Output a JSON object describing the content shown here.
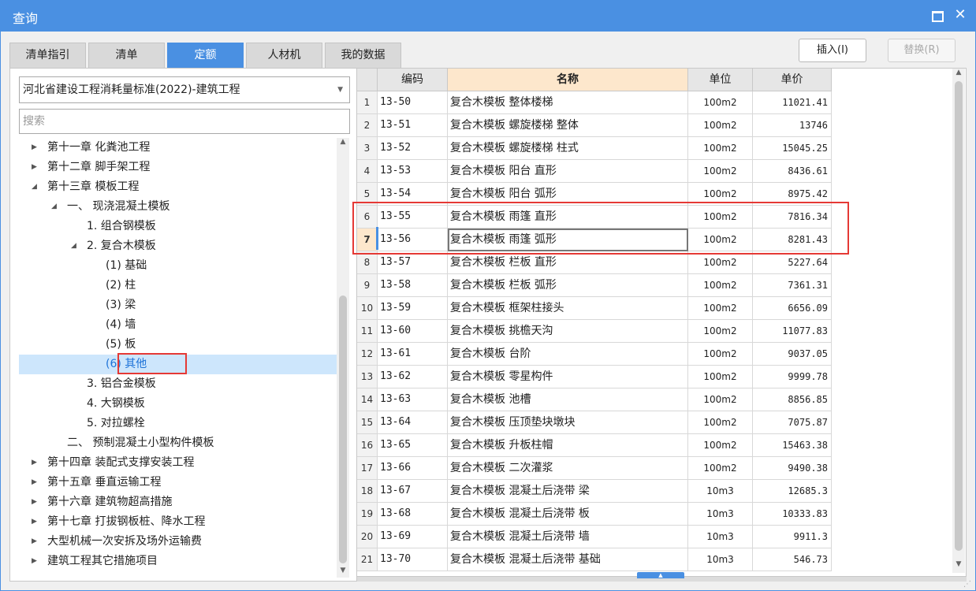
{
  "window": {
    "title": "查询"
  },
  "tabs": [
    {
      "label": "清单指引",
      "active": false
    },
    {
      "label": "清单",
      "active": false
    },
    {
      "label": "定额",
      "active": true
    },
    {
      "label": "人材机",
      "active": false
    },
    {
      "label": "我的数据",
      "active": false
    }
  ],
  "toolbar": {
    "insert_label": "插入(I)",
    "replace_label": "替换(R)"
  },
  "standard_select": {
    "value": "河北省建设工程消耗量标准(2022)-建筑工程"
  },
  "search": {
    "placeholder": "搜索"
  },
  "tree": [
    {
      "label": "第十一章 化粪池工程",
      "level": 0,
      "state": "collapsed"
    },
    {
      "label": "第十二章 脚手架工程",
      "level": 0,
      "state": "collapsed"
    },
    {
      "label": "第十三章 模板工程",
      "level": 0,
      "state": "expanded"
    },
    {
      "label": "一、 现浇混凝土模板",
      "level": 1,
      "state": "expanded"
    },
    {
      "label": "1. 组合钢模板",
      "level": 2,
      "state": "leaf"
    },
    {
      "label": "2. 复合木模板",
      "level": 2,
      "state": "expanded"
    },
    {
      "label": "(1) 基础",
      "level": 3,
      "state": "leaf"
    },
    {
      "label": "(2) 柱",
      "level": 3,
      "state": "leaf"
    },
    {
      "label": "(3) 梁",
      "level": 3,
      "state": "leaf"
    },
    {
      "label": "(4) 墙",
      "level": 3,
      "state": "leaf"
    },
    {
      "label": "(5) 板",
      "level": 3,
      "state": "leaf"
    },
    {
      "label": "(6) 其他",
      "level": 3,
      "state": "leaf",
      "selected": true
    },
    {
      "label": "3. 铝合金模板",
      "level": 2,
      "state": "leaf"
    },
    {
      "label": "4. 大钢模板",
      "level": 2,
      "state": "leaf"
    },
    {
      "label": "5. 对拉螺栓",
      "level": 2,
      "state": "leaf"
    },
    {
      "label": "二、 预制混凝土小型构件模板",
      "level": 1,
      "state": "leaf"
    },
    {
      "label": "第十四章 装配式支撑安装工程",
      "level": 0,
      "state": "collapsed"
    },
    {
      "label": "第十五章 垂直运输工程",
      "level": 0,
      "state": "collapsed"
    },
    {
      "label": "第十六章 建筑物超高措施",
      "level": 0,
      "state": "collapsed"
    },
    {
      "label": "第十七章 打拔钢板桩、降水工程",
      "level": 0,
      "state": "collapsed"
    },
    {
      "label": "大型机械一次安拆及场外运输费",
      "level": 0,
      "state": "collapsed"
    },
    {
      "label": "建筑工程其它措施项目",
      "level": 0,
      "state": "collapsed"
    }
  ],
  "grid": {
    "columns": [
      "编码",
      "名称",
      "单位",
      "单价"
    ],
    "current_row": 7,
    "rows": [
      {
        "no": "1",
        "code": "13-50",
        "name": "复合木模板 整体楼梯",
        "unit": "100m2",
        "price": "11021.41"
      },
      {
        "no": "2",
        "code": "13-51",
        "name": "复合木模板 螺旋楼梯 整体",
        "unit": "100m2",
        "price": "13746"
      },
      {
        "no": "3",
        "code": "13-52",
        "name": "复合木模板 螺旋楼梯 柱式",
        "unit": "100m2",
        "price": "15045.25"
      },
      {
        "no": "4",
        "code": "13-53",
        "name": "复合木模板 阳台 直形",
        "unit": "100m2",
        "price": "8436.61"
      },
      {
        "no": "5",
        "code": "13-54",
        "name": "复合木模板 阳台 弧形",
        "unit": "100m2",
        "price": "8975.42"
      },
      {
        "no": "6",
        "code": "13-55",
        "name": "复合木模板 雨篷 直形",
        "unit": "100m2",
        "price": "7816.34"
      },
      {
        "no": "7",
        "code": "13-56",
        "name": "复合木模板 雨篷 弧形",
        "unit": "100m2",
        "price": "8281.43"
      },
      {
        "no": "8",
        "code": "13-57",
        "name": "复合木模板 栏板 直形",
        "unit": "100m2",
        "price": "5227.64"
      },
      {
        "no": "9",
        "code": "13-58",
        "name": "复合木模板 栏板 弧形",
        "unit": "100m2",
        "price": "7361.31"
      },
      {
        "no": "10",
        "code": "13-59",
        "name": "复合木模板 框架柱接头",
        "unit": "100m2",
        "price": "6656.09"
      },
      {
        "no": "11",
        "code": "13-60",
        "name": "复合木模板 挑檐天沟",
        "unit": "100m2",
        "price": "11077.83"
      },
      {
        "no": "12",
        "code": "13-61",
        "name": "复合木模板 台阶",
        "unit": "100m2",
        "price": "9037.05"
      },
      {
        "no": "13",
        "code": "13-62",
        "name": "复合木模板 零星构件",
        "unit": "100m2",
        "price": "9999.78"
      },
      {
        "no": "14",
        "code": "13-63",
        "name": "复合木模板 池槽",
        "unit": "100m2",
        "price": "8856.85"
      },
      {
        "no": "15",
        "code": "13-64",
        "name": "复合木模板 压顶垫块墩块",
        "unit": "100m2",
        "price": "7075.87"
      },
      {
        "no": "16",
        "code": "13-65",
        "name": "复合木模板 升板柱帽",
        "unit": "100m2",
        "price": "15463.38"
      },
      {
        "no": "17",
        "code": "13-66",
        "name": "复合木模板 二次灌浆",
        "unit": "100m2",
        "price": "9490.38"
      },
      {
        "no": "18",
        "code": "13-67",
        "name": "复合木模板 混凝土后浇带 梁",
        "unit": "10m3",
        "price": "12685.3"
      },
      {
        "no": "19",
        "code": "13-68",
        "name": "复合木模板 混凝土后浇带 板",
        "unit": "10m3",
        "price": "10333.83"
      },
      {
        "no": "20",
        "code": "13-69",
        "name": "复合木模板 混凝土后浇带 墙",
        "unit": "10m3",
        "price": "9911.3"
      },
      {
        "no": "21",
        "code": "13-70",
        "name": "复合木模板 混凝土后浇带 基础",
        "unit": "10m3",
        "price": "546.73"
      }
    ]
  },
  "colors": {
    "accent": "#4a90e2",
    "highlight_border": "#e53935",
    "header_name_bg": "#fde7cc",
    "selected_tree_bg": "#cde6fc"
  }
}
